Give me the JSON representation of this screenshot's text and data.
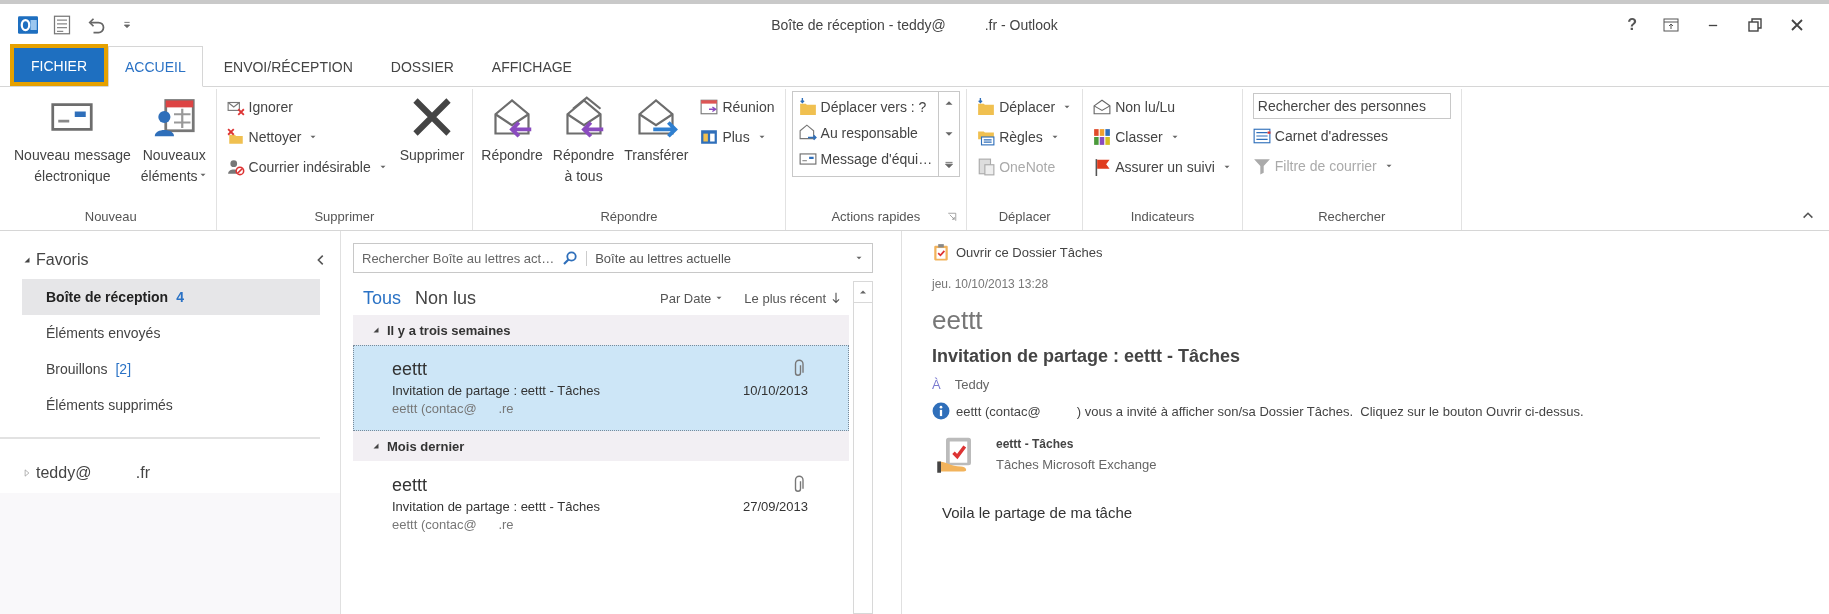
{
  "window": {
    "title": "Boîte de réception - teddy@          .fr - Outlook",
    "help": "?"
  },
  "tabs": [
    {
      "label": "FICHIER",
      "kind": "file",
      "selected": false,
      "highlighted": true
    },
    {
      "label": "ACCUEIL",
      "kind": "tab",
      "selected": true,
      "highlighted": false
    },
    {
      "label": "ENVOI/RÉCEPTION",
      "kind": "tab",
      "selected": false,
      "highlighted": false
    },
    {
      "label": "DOSSIER",
      "kind": "tab",
      "selected": false,
      "highlighted": false
    },
    {
      "label": "AFFICHAGE",
      "kind": "tab",
      "selected": false,
      "highlighted": false
    }
  ],
  "ribbon": {
    "groups": [
      {
        "name": "Nouveau",
        "columns": [
          {
            "kind": "large",
            "lines": [
              "Nouveau message",
              "électronique"
            ],
            "dropdown": false
          },
          {
            "kind": "large",
            "lines": [
              "Nouveaux",
              "éléments"
            ],
            "dropdown": true
          }
        ]
      },
      {
        "name": "Supprimer",
        "columns": [
          {
            "kind": "stack",
            "items": [
              {
                "label": "Ignorer",
                "dropdown": false,
                "disabled": false
              },
              {
                "label": "Nettoyer",
                "dropdown": true,
                "disabled": false
              },
              {
                "label": "Courrier indésirable",
                "dropdown": true,
                "disabled": false
              }
            ]
          },
          {
            "kind": "large",
            "lines": [
              "Supprimer"
            ],
            "dropdown": false
          }
        ]
      },
      {
        "name": "Répondre",
        "columns": [
          {
            "kind": "large",
            "lines": [
              "Répondre"
            ],
            "dropdown": false
          },
          {
            "kind": "large",
            "lines": [
              "Répondre",
              "à tous"
            ],
            "dropdown": false
          },
          {
            "kind": "large",
            "lines": [
              "Transférer"
            ],
            "dropdown": false
          },
          {
            "kind": "stack",
            "items": [
              {
                "label": "Réunion",
                "dropdown": false,
                "disabled": false
              },
              {
                "label": "Plus",
                "dropdown": true,
                "disabled": false
              }
            ]
          }
        ]
      },
      {
        "name": "Actions rapides",
        "launcher": true,
        "columns": [
          {
            "kind": "gallery",
            "items": [
              {
                "label": "Déplacer vers : ?"
              },
              {
                "label": "Au responsable"
              },
              {
                "label": "Message d'équi…"
              }
            ]
          }
        ]
      },
      {
        "name": "Déplacer",
        "columns": [
          {
            "kind": "stack",
            "items": [
              {
                "label": "Déplacer",
                "dropdown": true,
                "disabled": false
              },
              {
                "label": "Règles",
                "dropdown": true,
                "disabled": false
              },
              {
                "label": "OneNote",
                "dropdown": false,
                "disabled": true
              }
            ]
          }
        ]
      },
      {
        "name": "Indicateurs",
        "columns": [
          {
            "kind": "stack",
            "items": [
              {
                "label": "Non lu/Lu",
                "dropdown": false,
                "disabled": false
              },
              {
                "label": "Classer",
                "dropdown": true,
                "disabled": false
              },
              {
                "label": "Assurer un suivi",
                "dropdown": true,
                "disabled": false
              }
            ]
          }
        ]
      },
      {
        "name": "Rechercher",
        "columns": [
          {
            "kind": "search",
            "placeholder": "Rechercher des personnes",
            "items": [
              {
                "label": "Carnet d'adresses",
                "dropdown": false,
                "disabled": false
              },
              {
                "label": "Filtre de courrier",
                "dropdown": true,
                "disabled": true
              }
            ]
          }
        ]
      }
    ]
  },
  "navigation": {
    "favorites": {
      "label": "Favoris",
      "expanded": true,
      "folders": [
        {
          "name": "Boîte de réception",
          "count": "4",
          "count_bold": true,
          "selected": true
        },
        {
          "name": "Éléments envoyés",
          "selected": false
        },
        {
          "name": "Brouillons",
          "count": "[2]",
          "count_bold": false,
          "selected": false
        },
        {
          "name": "Éléments supprimés",
          "selected": false
        }
      ]
    },
    "accounts": [
      {
        "name": "teddy@          .fr",
        "expanded": false
      }
    ]
  },
  "message_list": {
    "search": {
      "placeholder": "Rechercher Boîte au lettres act…",
      "scope": "Boîte au lettres actuelle"
    },
    "filters": [
      {
        "label": "Tous",
        "selected": true
      },
      {
        "label": "Non lus",
        "selected": false
      }
    ],
    "sort": {
      "field": "Par Date",
      "order": "Le plus récent"
    },
    "groups": [
      {
        "label": "Il y a trois semaines",
        "expanded": true,
        "messages": [
          {
            "sender": "eettt",
            "subject": "Invitation de partage : eettt - Tâches",
            "date": "10/10/2013",
            "preview": "eettt (contac@      .re",
            "attachment": true,
            "selected": true
          }
        ]
      },
      {
        "label": "Mois dernier",
        "expanded": true,
        "messages": [
          {
            "sender": "eettt",
            "subject": "Invitation de partage : eettt - Tâches",
            "date": "27/09/2013",
            "preview": "eettt (contac@      .re",
            "attachment": true,
            "selected": false
          }
        ]
      }
    ]
  },
  "reading_pane": {
    "action": "Ouvrir ce Dossier Tâches",
    "sent": "jeu. 10/10/2013 13:28",
    "sender": "eettt",
    "subject": "Invitation de partage : eettt - Tâches",
    "to_label": "À",
    "to": "Teddy",
    "info": "eettt (contac@          ) vous a invité à afficher son/sa Dossier Tâches.  Cliquez sur le bouton Ouvrir ci-dessus.",
    "attachment": {
      "title": "eettt - Tâches",
      "subtitle": "Tâches Microsoft Exchange"
    },
    "body": "Voila le partage de ma tâche"
  }
}
